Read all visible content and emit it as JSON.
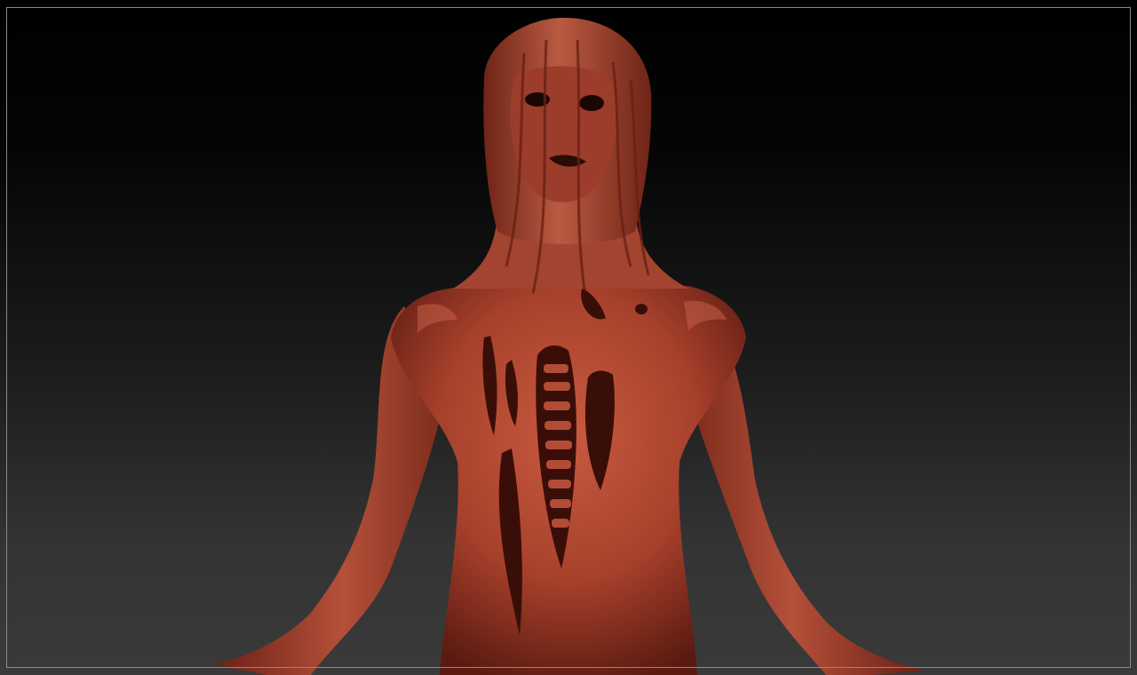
{
  "app": {
    "viewport_label": "",
    "colors": {
      "background_top": "#000000",
      "background_bottom": "#3a3a3a",
      "frame_border": "#8a8a8a",
      "material_base": "#a8412c",
      "material_highlight": "#d06a50",
      "material_shadow": "#5a1a10"
    },
    "model": {
      "subject": "sculpted-figure-back",
      "material": "red-wax"
    }
  }
}
